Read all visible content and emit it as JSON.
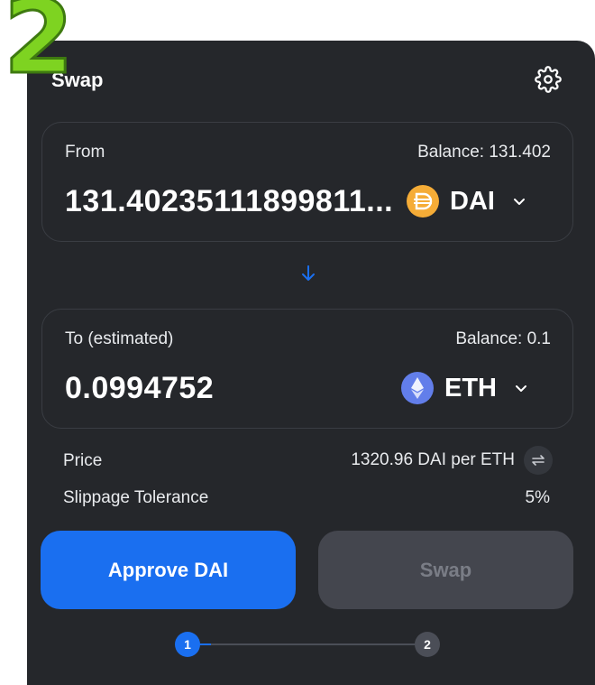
{
  "step_badge": "2",
  "swap_card": {
    "title": "Swap",
    "settings_icon": "gear-icon",
    "from": {
      "label": "From",
      "balance": "Balance: 131.402",
      "amount": "131.40235111899811",
      "token_symbol": "DAI",
      "token_icon": "dai-token-icon"
    },
    "direction_icon": "arrow-down-icon",
    "to": {
      "label": "To (estimated)",
      "balance": "Balance: 0.1",
      "amount": "0.0994752",
      "token_symbol": "ETH",
      "token_icon": "eth-token-icon"
    },
    "price": {
      "label": "Price",
      "value": "1320.96 DAI per ETH",
      "invert_icon": "swap-arrows-icon"
    },
    "slippage": {
      "label": "Slippage Tolerance",
      "value": "5%"
    },
    "buttons": {
      "approve_label": "Approve DAI",
      "swap_label": "Swap"
    },
    "stepper": {
      "steps": [
        "1",
        "2"
      ],
      "current_step": 1
    }
  },
  "colors": {
    "card_background": "#25272b",
    "accent_blue": "#1a6ff0",
    "disabled_button": "#44464e",
    "step_badge_green": "#7ed321",
    "dai_yellow": "#f5ac37",
    "eth_purple": "#627eea"
  }
}
